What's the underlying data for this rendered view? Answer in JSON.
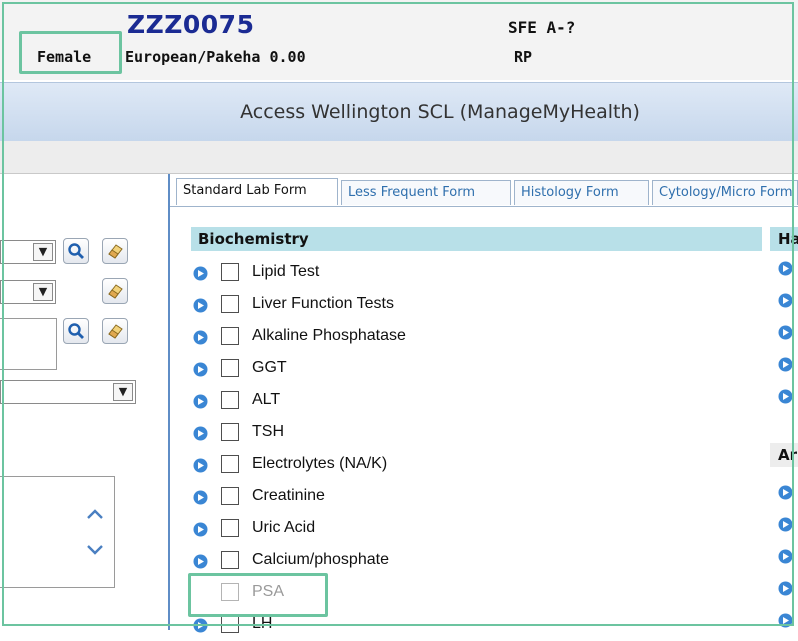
{
  "patient": {
    "id": "ZZZ0075",
    "gender": "Female",
    "ethnicity": "European/Pakeha 0.00",
    "sfe": "SFE A-?",
    "code": "RP"
  },
  "window": {
    "title": "Access Wellington SCL (ManageMyHealth)"
  },
  "tabs": [
    {
      "label": "Standard Lab Form",
      "active": true
    },
    {
      "label": "Less Frequent Form",
      "active": false
    },
    {
      "label": "Histology Form",
      "active": false
    },
    {
      "label": "Cytology/Micro Form",
      "active": false
    }
  ],
  "sections": {
    "biochemistry": {
      "title": "Biochemistry",
      "items": [
        {
          "label": "Lipid Test",
          "enabled": true
        },
        {
          "label": "Liver Function Tests",
          "enabled": true
        },
        {
          "label": "Alkaline Phosphatase",
          "enabled": true
        },
        {
          "label": "GGT",
          "enabled": true
        },
        {
          "label": "ALT",
          "enabled": true
        },
        {
          "label": "TSH",
          "enabled": true
        },
        {
          "label": "Electrolytes (NA/K)",
          "enabled": true
        },
        {
          "label": "Creatinine",
          "enabled": true
        },
        {
          "label": "Uric Acid",
          "enabled": true
        },
        {
          "label": "Calcium/phosphate",
          "enabled": true
        },
        {
          "label": "PSA",
          "enabled": false
        },
        {
          "label": "LH",
          "enabled": true
        }
      ]
    },
    "right_header_1": "Ha",
    "right_header_2": "Ar"
  },
  "icons": {
    "info_arrow": "circle-arrow-right-icon",
    "search": "search-icon",
    "eraser": "eraser-icon",
    "scroll_up": "chevron-up-icon",
    "scroll_down": "chevron-down-icon"
  },
  "colors": {
    "highlight": "#6cc4a0",
    "patient_id": "#1b2b93",
    "section_header": "#b8e0e8",
    "tab_link": "#2f6fad",
    "arrow_icon": "#3a86d4"
  }
}
